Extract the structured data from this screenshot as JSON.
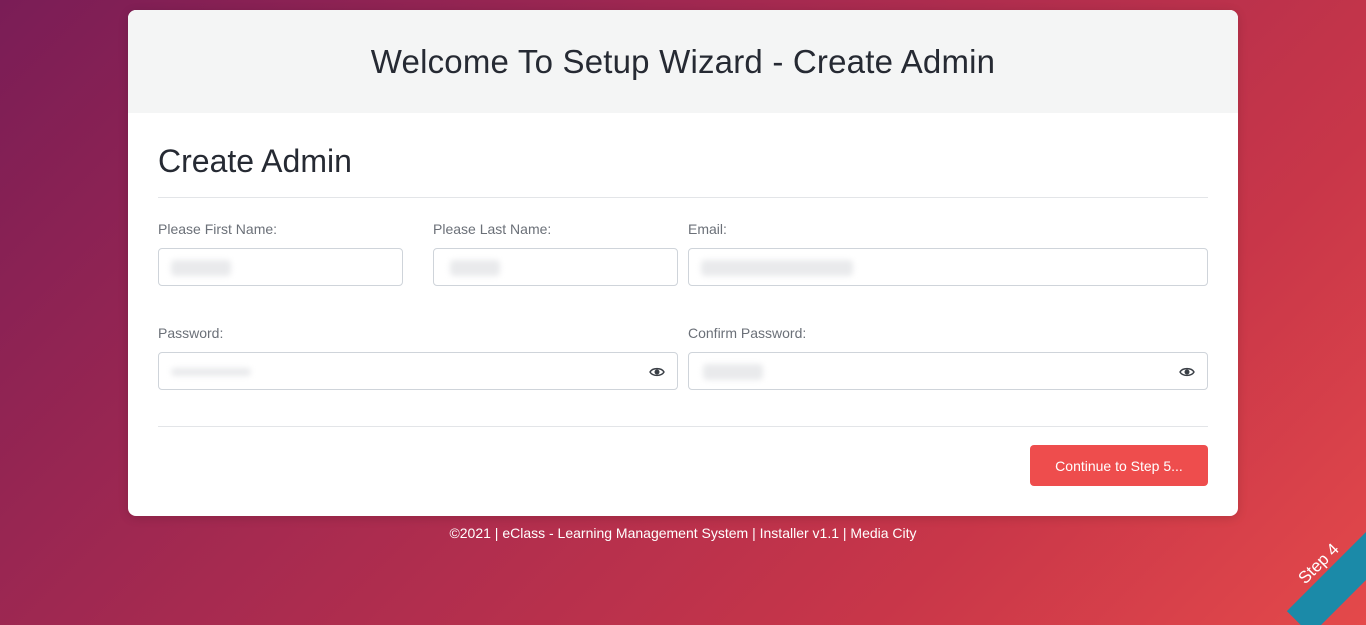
{
  "header": {
    "title": "Welcome To Setup Wizard - Create Admin"
  },
  "form": {
    "section_title": "Create Admin",
    "first_name": {
      "label": "Please First Name:",
      "value": ""
    },
    "last_name": {
      "label": "Please Last Name:",
      "value": ""
    },
    "email": {
      "label": "Email:",
      "value": ""
    },
    "password": {
      "label": "Password:",
      "value": ""
    },
    "confirm_password": {
      "label": "Confirm Password:",
      "value": ""
    },
    "submit_label": "Continue to Step 5..."
  },
  "footer": {
    "text": "©2021 | eClass - Learning Management System | Installer v1.1 | Media City"
  },
  "ribbon": {
    "text": "Step 4"
  },
  "colors": {
    "accent": "#ee4d4d",
    "ribbon": "#1b8aa8"
  },
  "icons": {
    "password_toggle": "eye-icon"
  }
}
